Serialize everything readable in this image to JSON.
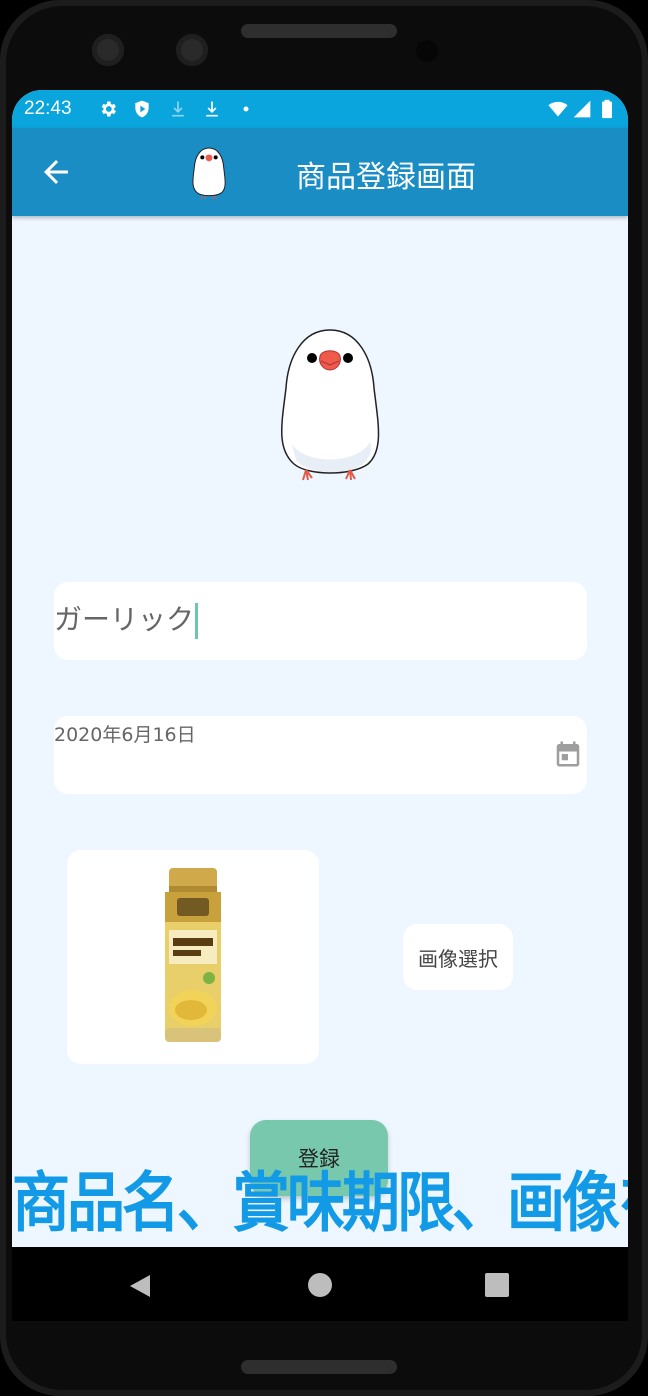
{
  "status_bar": {
    "time": "22:43",
    "left_icons": [
      "gear-icon",
      "shield-play-icon",
      "download-icon",
      "download-icon",
      "dot-icon"
    ],
    "right_icons": [
      "wifi-icon",
      "signal-icon",
      "battery-icon"
    ]
  },
  "app_bar": {
    "title": "商品登録画面",
    "back_icon": "arrow-back-icon",
    "logo": "java-sparrow-logo"
  },
  "form": {
    "product_name_value": "ガーリック",
    "expiry_date_value": "2020年6月16日",
    "calendar_icon": "calendar-icon",
    "select_image_label": "画像選択",
    "register_label": "登録"
  },
  "caption": "商品名、賞味期限、画像を登録しよう！",
  "nav_bar": {
    "icons": [
      "nav-back-icon",
      "nav-home-icon",
      "nav-recents-icon"
    ]
  },
  "colors": {
    "status_bar": "#0aa5dd",
    "app_bar": "#1a8dc4",
    "background": "#eef7ff",
    "register_button": "#78c8ad",
    "caption_text": "#139ae6"
  }
}
